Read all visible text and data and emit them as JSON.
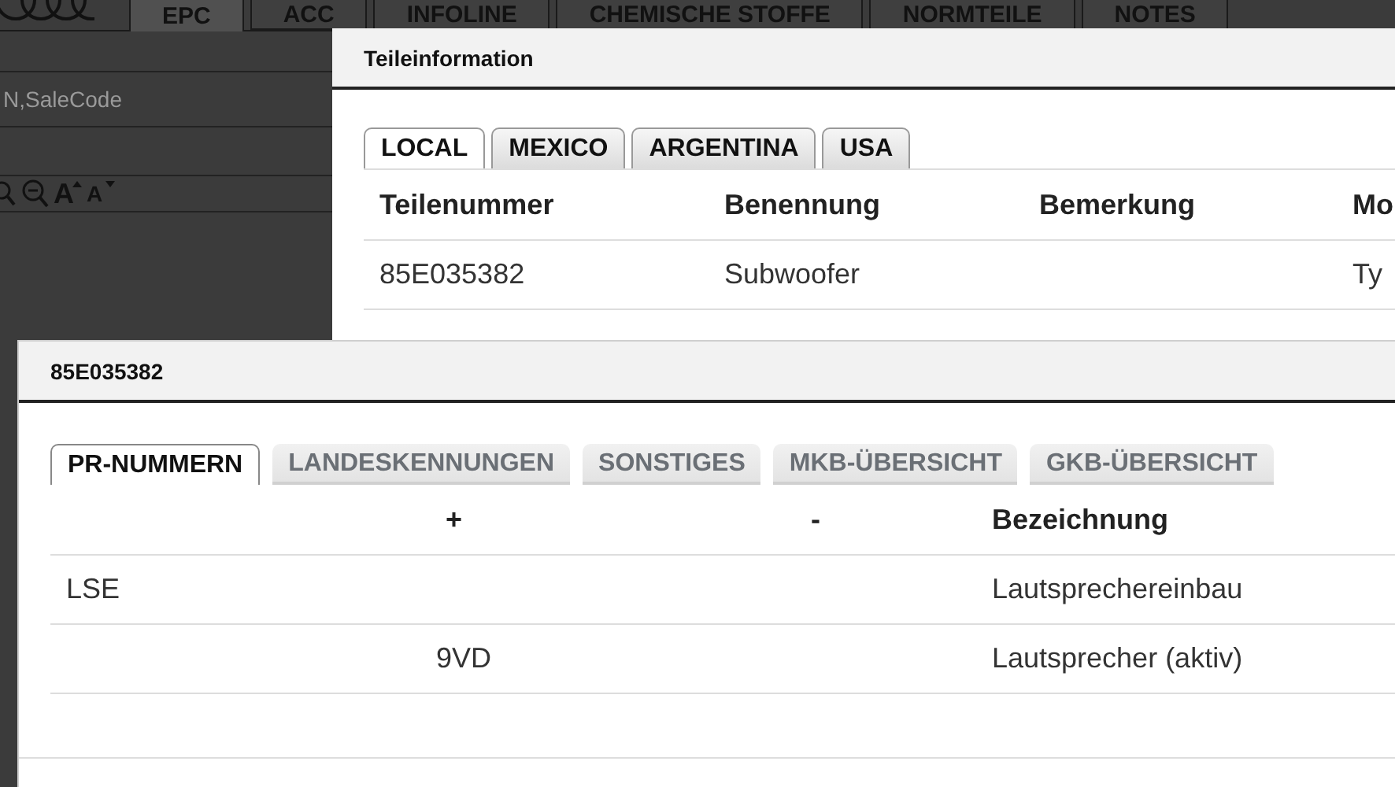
{
  "app": {
    "tabs": [
      {
        "label": "EPC",
        "selected": true
      },
      {
        "label": "ACC",
        "selected": false
      },
      {
        "label": "INFOLINE",
        "selected": false
      },
      {
        "label": "CHEMISCHE STOFFE",
        "selected": false
      },
      {
        "label": "NORMTEILE",
        "selected": false
      },
      {
        "label": "NOTES",
        "selected": false
      }
    ],
    "search": {
      "placeholder": "N,SaleCode"
    },
    "font_buttons": [
      {
        "label": "A",
        "kind": "larger"
      },
      {
        "label": "A",
        "kind": "smaller"
      }
    ]
  },
  "part_dialog": {
    "title": "Teileinformation",
    "tabs": [
      {
        "label": "LOCAL",
        "selected": true
      },
      {
        "label": "MEXICO",
        "selected": false
      },
      {
        "label": "ARGENTINA",
        "selected": false
      },
      {
        "label": "USA",
        "selected": false
      }
    ],
    "columns": [
      "Teilenummer",
      "Benennung",
      "Bemerkung",
      "Mo"
    ],
    "rows": [
      [
        "85E035382",
        "Subwoofer",
        "",
        "Ty"
      ]
    ]
  },
  "pr_dialog": {
    "title": "85E035382",
    "tabs": [
      {
        "label": "PR-NUMMERN",
        "selected": true
      },
      {
        "label": "LANDESKENNUNGEN",
        "selected": false
      },
      {
        "label": "SONSTIGES",
        "selected": false
      },
      {
        "label": "MKB-ÜBERSICHT",
        "selected": false
      },
      {
        "label": "GKB-ÜBERSICHT",
        "selected": false
      }
    ],
    "columns": [
      "",
      "+",
      "-",
      "Bezeichnung"
    ],
    "rows": [
      [
        "LSE",
        "",
        "",
        "Lautsprechereinbau"
      ],
      [
        "",
        "9VD",
        "",
        "Lautsprecher (aktiv)"
      ]
    ]
  }
}
